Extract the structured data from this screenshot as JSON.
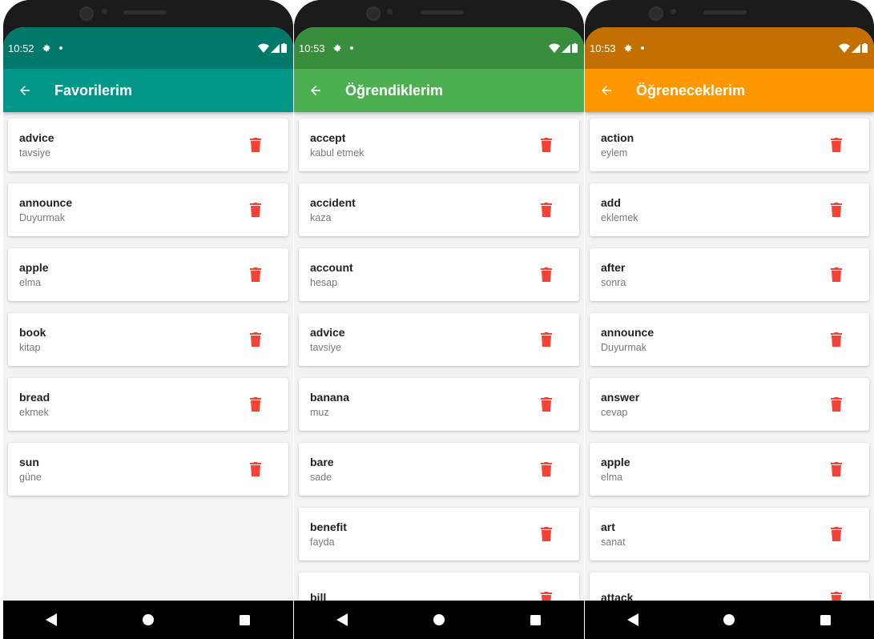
{
  "screens": [
    {
      "status": {
        "time": "10:52"
      },
      "appbar": {
        "title": "Favorilerim",
        "color": "#009688",
        "status_color": "#00796b"
      },
      "items": [
        {
          "word": "advice",
          "meaning": "tavsiye"
        },
        {
          "word": "announce",
          "meaning": "Duyurmak"
        },
        {
          "word": "apple",
          "meaning": "elma"
        },
        {
          "word": "book",
          "meaning": "kitap"
        },
        {
          "word": "bread",
          "meaning": "ekmek"
        },
        {
          "word": "sun",
          "meaning": "güne"
        }
      ]
    },
    {
      "status": {
        "time": "10:53"
      },
      "appbar": {
        "title": "Öğrendiklerim",
        "color": "#4caf50",
        "status_color": "#388e3c"
      },
      "items": [
        {
          "word": "accept",
          "meaning": "kabul etmek"
        },
        {
          "word": "accident",
          "meaning": "kaza"
        },
        {
          "word": "account",
          "meaning": "hesap"
        },
        {
          "word": "advice",
          "meaning": "tavsiye"
        },
        {
          "word": "banana",
          "meaning": "muz"
        },
        {
          "word": "bare",
          "meaning": "sade"
        },
        {
          "word": "benefit",
          "meaning": "fayda"
        },
        {
          "word": "bill",
          "meaning": ""
        }
      ]
    },
    {
      "status": {
        "time": "10:53"
      },
      "appbar": {
        "title": "Öğreneceklerim",
        "color": "#ff9800",
        "status_color": "#c47000"
      },
      "items": [
        {
          "word": "action",
          "meaning": "eylem"
        },
        {
          "word": "add",
          "meaning": "eklemek"
        },
        {
          "word": "after",
          "meaning": "sonra"
        },
        {
          "word": "announce",
          "meaning": "Duyurmak"
        },
        {
          "word": "answer",
          "meaning": "cevap"
        },
        {
          "word": "apple",
          "meaning": "elma"
        },
        {
          "word": "art",
          "meaning": "sanat"
        },
        {
          "word": "attack",
          "meaning": ""
        }
      ]
    }
  ],
  "icons": {
    "back": "arrow-back-icon",
    "settings": "gear-icon",
    "delete": "trash-icon",
    "nav_back": "triangle-back-icon",
    "nav_home": "circle-home-icon",
    "nav_recents": "square-recents-icon"
  },
  "colors": {
    "delete": "#f44336"
  }
}
